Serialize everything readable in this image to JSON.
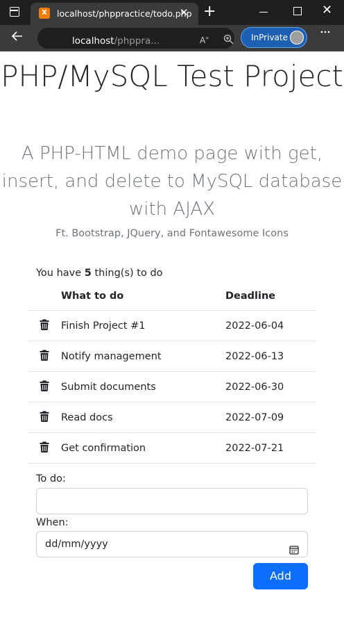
{
  "browser": {
    "tab_title": "localhost/phppractice/todo.php",
    "tab_favicon_letter": "X",
    "url_host": "localhost",
    "url_rest": "/phppra...",
    "inprivate_label": "InPrivate",
    "close_glyph": "✕",
    "new_tab_glyph": "+"
  },
  "page": {
    "title": "PHP/MySQL Test Project",
    "lead": "A PHP-HTML demo page with get, insert, and delete to MySQL database with AJAX",
    "subtitle": "Ft. Bootstrap, JQuery, and Fontawesome Icons",
    "count_prefix": "You have ",
    "count_value": "5",
    "count_suffix": " thing(s) to do"
  },
  "table": {
    "headers": [
      "What to do",
      "Deadline"
    ],
    "rows": [
      {
        "task": "Finish Project #1",
        "deadline": "2022-06-04"
      },
      {
        "task": "Notify management",
        "deadline": "2022-06-13"
      },
      {
        "task": "Submit documents",
        "deadline": "2022-06-30"
      },
      {
        "task": "Read docs",
        "deadline": "2022-07-09"
      },
      {
        "task": "Get confirmation",
        "deadline": "2022-07-21"
      }
    ]
  },
  "form": {
    "todo_label": "To do:",
    "todo_value": "",
    "when_label": "When:",
    "when_placeholder": "dd/mm/yyyy",
    "add_label": "Add"
  },
  "colors": {
    "primary": "#0d6efd",
    "muted": "#6c757d",
    "chrome_dark": "#1f1f1f",
    "chrome_mid": "#3b3b3b",
    "inprivate": "#1d5fb3"
  },
  "icons": [
    "tab-panel-icon",
    "xampp-favicon",
    "close-icon",
    "new-tab-icon",
    "minimize-icon",
    "maximize-icon",
    "back-icon",
    "read-aloud-icon",
    "zoom-icon",
    "favorites-icon",
    "more-icon",
    "trash-icon",
    "calendar-icon"
  ]
}
